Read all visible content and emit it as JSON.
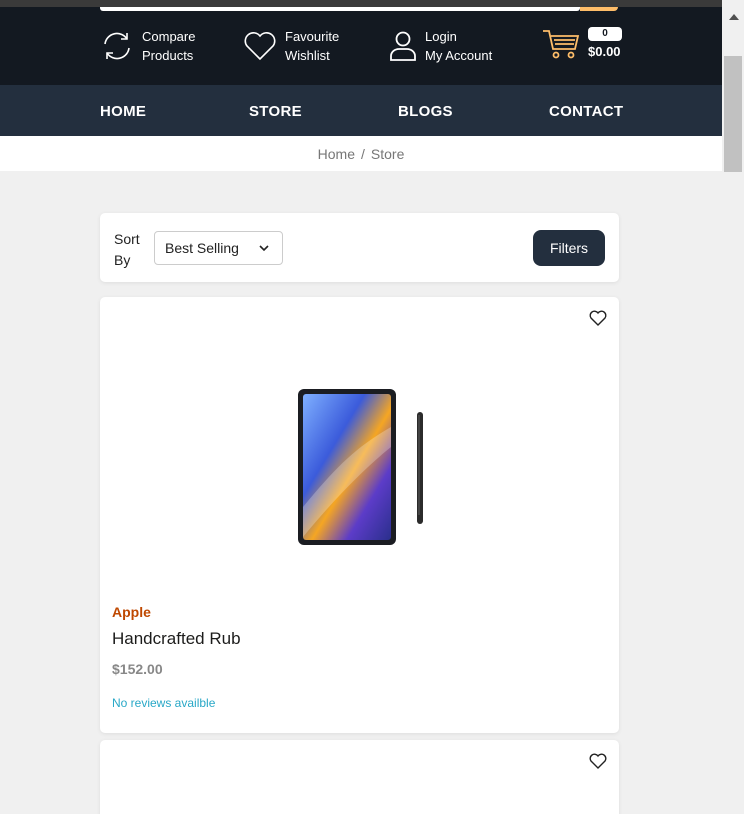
{
  "header": {
    "compare": {
      "line1": "Compare",
      "line2": "Products"
    },
    "wishlist": {
      "line1": "Favourite",
      "line2": "Wishlist"
    },
    "account": {
      "line1": "Login",
      "line2": "My Account"
    },
    "cart": {
      "count": "0",
      "total": "$0.00"
    }
  },
  "nav": [
    "HOME",
    "STORE",
    "BLOGS",
    "CONTACT"
  ],
  "breadcrumb": {
    "home": "Home",
    "separator": "/",
    "current": "Store"
  },
  "sort": {
    "label": "Sort By",
    "selected": "Best Selling",
    "filters_label": "Filters"
  },
  "products": [
    {
      "brand": "Apple",
      "name": "Handcrafted Rub",
      "price": "$152.00",
      "reviews": "No reviews availble"
    }
  ],
  "colors": {
    "header_bg": "#131921",
    "nav_bg": "#232f3e",
    "brand": "#bf4800",
    "accent": "#febd69",
    "review_link": "#29a8c7"
  }
}
